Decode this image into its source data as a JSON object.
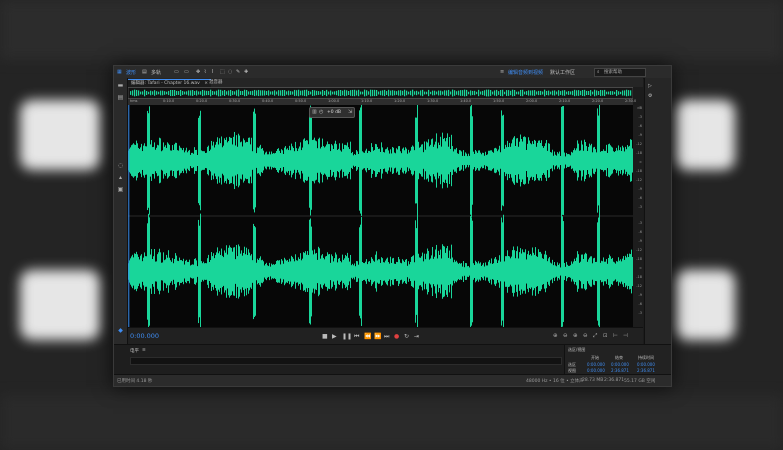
{
  "menubar": {
    "workspace_label": "波形",
    "multitrack_label": "多轨",
    "workspace_preset": "编辑音频到视频",
    "workspace_default": "默认工作区",
    "search_placeholder": "搜索帮助"
  },
  "tabs": [
    {
      "label": "编辑器: Tafari - Chapter 16.wav"
    },
    {
      "label": "混音器"
    }
  ],
  "ruler": {
    "ticks": [
      "hms",
      "0:10.0",
      "0:20.0",
      "0:30.0",
      "0:40.0",
      "0:50.0",
      "1:00.0",
      "1:10.0",
      "1:20.0",
      "1:30.0",
      "1:40.0",
      "1:50.0",
      "2:00.0",
      "2:10.0",
      "2:20.0",
      "2:30.0"
    ]
  },
  "hud": {
    "gain_value": "+0 dB"
  },
  "db_scale": {
    "top_channel": [
      "dB",
      "-3",
      "-6",
      "-9",
      "-12",
      "-18",
      "∞",
      "-18",
      "-12",
      "-9",
      "-6",
      "-3"
    ],
    "bottom_channel": [
      "-3",
      "-6",
      "-9",
      "-12",
      "-18",
      "∞",
      "-18",
      "-12",
      "-9",
      "-6",
      "-3"
    ]
  },
  "time": {
    "current": "0:00.000"
  },
  "panels": {
    "levels_label": "电平",
    "selection_label": "选区/视图",
    "selection_headers": [
      "开始",
      "结束",
      "持续时间"
    ],
    "selection_rows": [
      {
        "label": "选区",
        "start": "0:00.000",
        "end": "0:00.000",
        "duration": "0:00.000"
      },
      {
        "label": "视图",
        "start": "0:00.000",
        "end": "2:36.871",
        "duration": "2:36.871"
      }
    ]
  },
  "status": {
    "left": "已用时间 4.18 秒",
    "format": "48000 Hz • 16 位 • 立体声",
    "size": "28.73 MB",
    "duration": "2:36.871",
    "free": "55.17 GB 空闲"
  },
  "colors": {
    "waveform": "#19d69a",
    "timecode": "#3f8df3",
    "playhead": "#3a8ef0"
  }
}
